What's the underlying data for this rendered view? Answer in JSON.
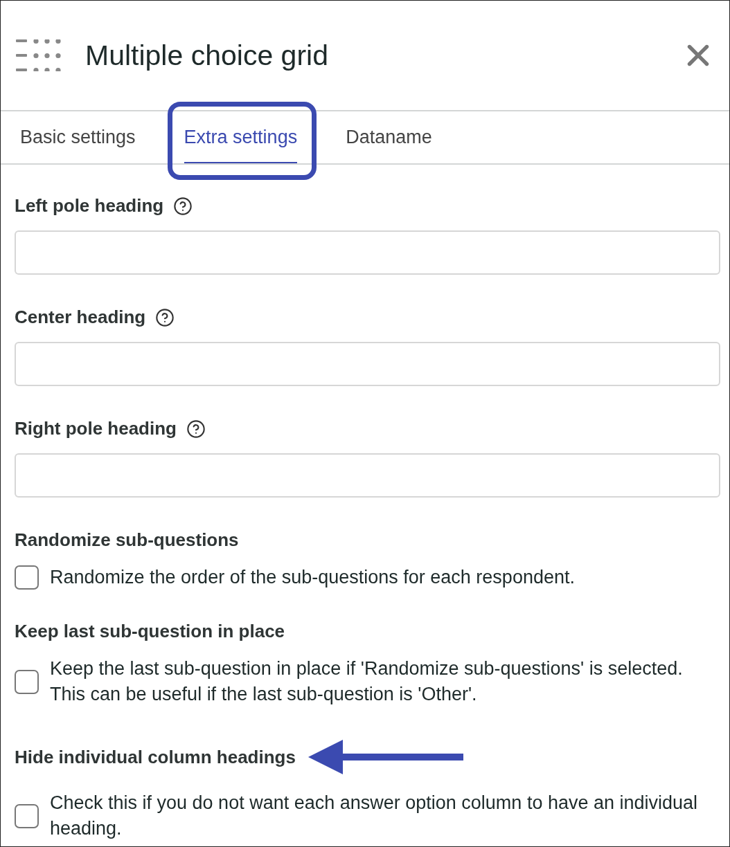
{
  "header": {
    "title": "Multiple choice grid"
  },
  "tabs": [
    {
      "label": "Basic settings",
      "selected": false,
      "highlighted": false
    },
    {
      "label": "Extra settings",
      "selected": true,
      "highlighted": true
    },
    {
      "label": "Dataname",
      "selected": false,
      "highlighted": false
    }
  ],
  "fields": [
    {
      "label": "Left pole heading"
    },
    {
      "label": "Center heading"
    },
    {
      "label": "Right pole heading"
    }
  ],
  "options": [
    {
      "heading": "Randomize sub-questions",
      "description": "Randomize the order of the sub-questions for each respondent.",
      "checked": false,
      "arrow": false
    },
    {
      "heading": "Keep last sub-question in place",
      "description": "Keep the last sub-question in place if 'Randomize sub-questions' is selected. This can be useful if the last sub-question is 'Other'.",
      "checked": false,
      "arrow": false
    },
    {
      "heading": "Hide individual column headings",
      "description": "Check this if you do not want each answer option column to have an individual heading.",
      "checked": false,
      "arrow": true
    }
  ]
}
